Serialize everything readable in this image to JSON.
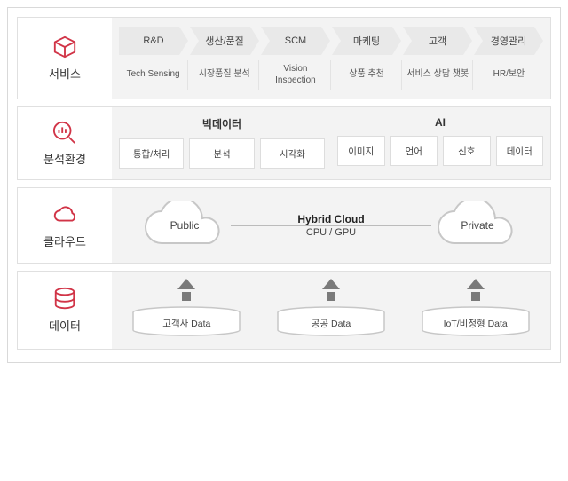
{
  "rows": {
    "service": {
      "label": "서비스",
      "stages": [
        "R&D",
        "생산/품질",
        "SCM",
        "마케팅",
        "고객",
        "경영관리"
      ],
      "subs": [
        "Tech Sensing",
        "시장품질 분석",
        "Vision Inspection",
        "상품 추천",
        "서비스 상담 챗봇",
        "HR/보안"
      ]
    },
    "analysis": {
      "label": "분석환경",
      "groups": [
        {
          "title": "빅데이터",
          "items": [
            "통합/처리",
            "분석",
            "시각화"
          ]
        },
        {
          "title": "AI",
          "items": [
            "이미지",
            "언어",
            "신호",
            "데이터"
          ]
        }
      ]
    },
    "cloud": {
      "label": "클라우드",
      "left": "Public",
      "right": "Private",
      "title": "Hybrid Cloud",
      "subtitle": "CPU / GPU"
    },
    "data": {
      "label": "데이터",
      "items": [
        "고객사 Data",
        "공공 Data",
        "IoT/비정형 Data"
      ]
    }
  },
  "colors": {
    "accent": "#d13447",
    "panel": "#f3f3f3",
    "border": "#e0e0e0",
    "arrow": "#7a7a7a"
  }
}
